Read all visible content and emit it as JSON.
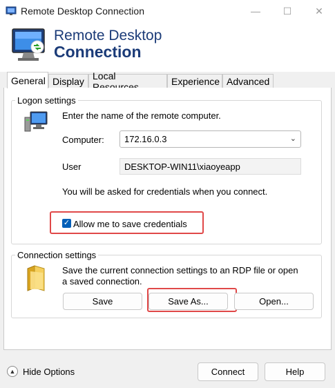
{
  "window": {
    "title": "Remote Desktop Connection"
  },
  "banner": {
    "line1": "Remote Desktop",
    "line2": "Connection"
  },
  "tabs": [
    {
      "label": "General",
      "active": true
    },
    {
      "label": "Display",
      "active": false
    },
    {
      "label": "Local Resources",
      "active": false
    },
    {
      "label": "Experience",
      "active": false
    },
    {
      "label": "Advanced",
      "active": false
    }
  ],
  "logon": {
    "group_label": "Logon settings",
    "instruction": "Enter the name of the remote computer.",
    "computer_label": "Computer:",
    "computer_value": "172.16.0.3",
    "user_label": "User",
    "user_value": "DESKTOP-WIN11\\xiaoyeapp",
    "credentials_note": "You will be asked for credentials when you connect.",
    "allow_save_label": "Allow me to save credentials",
    "allow_save_checked": true
  },
  "connection": {
    "group_label": "Connection settings",
    "description_line1": "Save the current connection settings to an RDP file or open",
    "description_line2": "a saved connection.",
    "save_label": "Save",
    "save_as_label": "Save As...",
    "open_label": "Open..."
  },
  "footer": {
    "hide_options_label": "Hide Options",
    "connect_label": "Connect",
    "help_label": "Help"
  },
  "colors": {
    "accent": "#005fb8",
    "banner_text": "#1b3b78",
    "highlight": "#e04848"
  }
}
